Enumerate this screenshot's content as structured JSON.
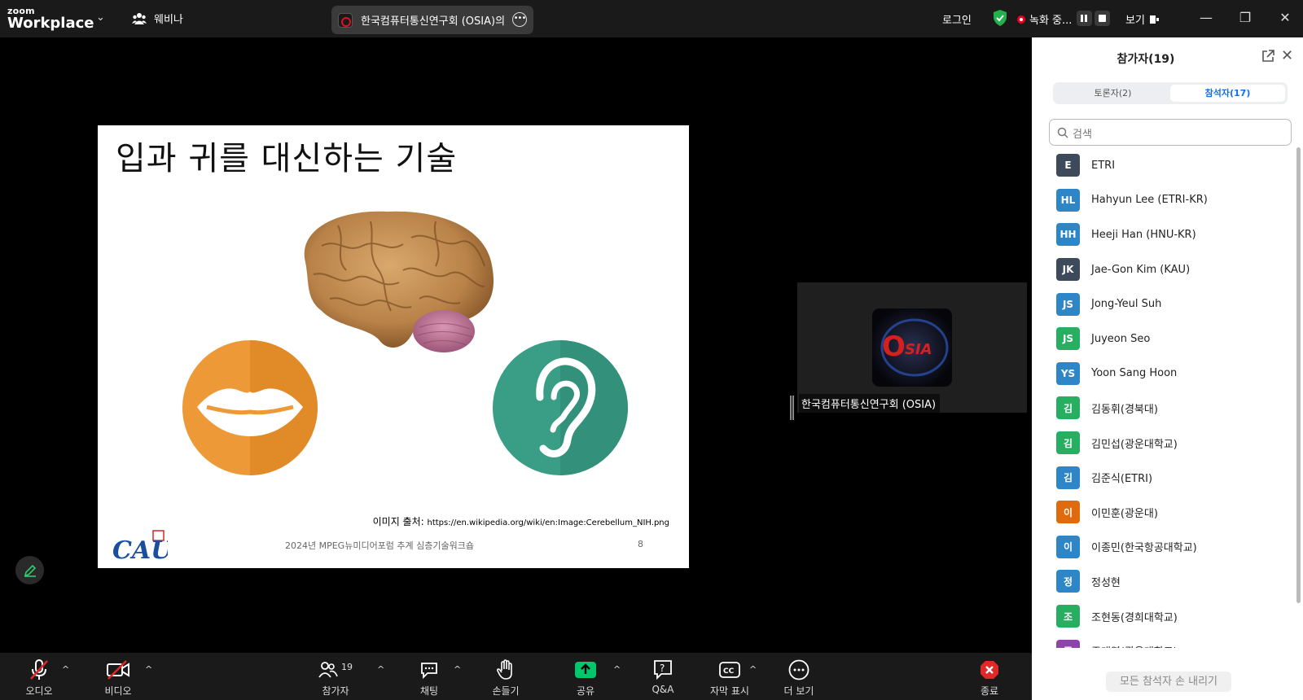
{
  "topbar": {
    "logo_small": "zoom",
    "logo_large": "Workplace",
    "webinar_label": "웨비나",
    "meeting_title": "한국컴퓨터통신연구회 (OSIA)의",
    "login_label": "로그인",
    "recording_label": "녹화 중...",
    "view_label": "보기"
  },
  "slide": {
    "title": "입과 귀를 대신하는 기술",
    "source_label": "이미지 출처:",
    "source_url": "https://en.wikipedia.org/wiki/en:Image:Cerebellum_NIH.png",
    "footer": "2024년 MPEG뉴미디어포럼 추계 심층기술워크숍",
    "page_number": "8",
    "logo_text": "CAU"
  },
  "video_tile": {
    "name": "한국컴퓨터통신연구회 (OSIA)",
    "logo_text": "OSIA"
  },
  "toolbar": {
    "audio": "오디오",
    "video": "비디오",
    "participants": "참가자",
    "participants_count": "19",
    "chat": "채팅",
    "raise_hand": "손들기",
    "share": "공유",
    "qa": "Q&A",
    "captions": "자막 표시",
    "more": "더 보기",
    "end": "종료"
  },
  "panel": {
    "title": "참가자(19)",
    "tab_panelists": "토론자(2)",
    "tab_attendees": "참석자(17)",
    "search_placeholder": "검색",
    "lower_all_hands": "모든 참석자 손 내리기",
    "participants": [
      {
        "initials": "E",
        "name": "ETRI",
        "color": "#3d4a5c"
      },
      {
        "initials": "HL",
        "name": "Hahyun Lee (ETRI-KR)",
        "color": "#2f86c6"
      },
      {
        "initials": "HH",
        "name": "Heeji Han (HNU-KR)",
        "color": "#2f86c6"
      },
      {
        "initials": "JK",
        "name": "Jae-Gon Kim (KAU)",
        "color": "#3d4a5c"
      },
      {
        "initials": "JS",
        "name": "Jong-Yeul Suh",
        "color": "#2f86c6"
      },
      {
        "initials": "JS",
        "name": "Juyeon Seo",
        "color": "#27ae60"
      },
      {
        "initials": "YS",
        "name": "Yoon Sang Hoon",
        "color": "#2f86c6"
      },
      {
        "initials": "김",
        "name": "김동휘(경북대)",
        "color": "#27ae60"
      },
      {
        "initials": "김",
        "name": "김민섭(광운대학교)",
        "color": "#27ae60"
      },
      {
        "initials": "김",
        "name": "김준식(ETRI)",
        "color": "#2f86c6"
      },
      {
        "initials": "이",
        "name": "이민훈(광운대)",
        "color": "#e06a0e"
      },
      {
        "initials": "이",
        "name": "이종민(한국항공대학교)",
        "color": "#2f86c6"
      },
      {
        "initials": "정",
        "name": "정성현",
        "color": "#2f86c6"
      },
      {
        "initials": "조",
        "name": "조현동(경희대학교)",
        "color": "#27ae60"
      },
      {
        "initials": "주",
        "name": "주대영(광운대학교)",
        "color": "#8e44ad"
      }
    ]
  },
  "colors": {
    "accent": "#0e71eb",
    "share_green": "#00c76b",
    "end_red": "#e02828",
    "lips_orange": "#ee9937",
    "ear_teal": "#3a9e87"
  }
}
